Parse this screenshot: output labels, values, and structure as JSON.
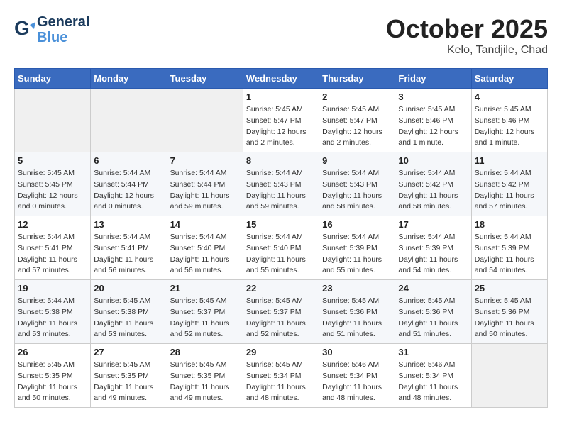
{
  "header": {
    "logo_line1": "General",
    "logo_line2": "Blue",
    "month": "October 2025",
    "location": "Kelo, Tandjile, Chad"
  },
  "weekdays": [
    "Sunday",
    "Monday",
    "Tuesday",
    "Wednesday",
    "Thursday",
    "Friday",
    "Saturday"
  ],
  "weeks": [
    [
      {
        "day": "",
        "info": ""
      },
      {
        "day": "",
        "info": ""
      },
      {
        "day": "",
        "info": ""
      },
      {
        "day": "1",
        "info": "Sunrise: 5:45 AM\nSunset: 5:47 PM\nDaylight: 12 hours and 2 minutes."
      },
      {
        "day": "2",
        "info": "Sunrise: 5:45 AM\nSunset: 5:47 PM\nDaylight: 12 hours and 2 minutes."
      },
      {
        "day": "3",
        "info": "Sunrise: 5:45 AM\nSunset: 5:46 PM\nDaylight: 12 hours and 1 minute."
      },
      {
        "day": "4",
        "info": "Sunrise: 5:45 AM\nSunset: 5:46 PM\nDaylight: 12 hours and 1 minute."
      }
    ],
    [
      {
        "day": "5",
        "info": "Sunrise: 5:45 AM\nSunset: 5:45 PM\nDaylight: 12 hours and 0 minutes."
      },
      {
        "day": "6",
        "info": "Sunrise: 5:44 AM\nSunset: 5:44 PM\nDaylight: 12 hours and 0 minutes."
      },
      {
        "day": "7",
        "info": "Sunrise: 5:44 AM\nSunset: 5:44 PM\nDaylight: 11 hours and 59 minutes."
      },
      {
        "day": "8",
        "info": "Sunrise: 5:44 AM\nSunset: 5:43 PM\nDaylight: 11 hours and 59 minutes."
      },
      {
        "day": "9",
        "info": "Sunrise: 5:44 AM\nSunset: 5:43 PM\nDaylight: 11 hours and 58 minutes."
      },
      {
        "day": "10",
        "info": "Sunrise: 5:44 AM\nSunset: 5:42 PM\nDaylight: 11 hours and 58 minutes."
      },
      {
        "day": "11",
        "info": "Sunrise: 5:44 AM\nSunset: 5:42 PM\nDaylight: 11 hours and 57 minutes."
      }
    ],
    [
      {
        "day": "12",
        "info": "Sunrise: 5:44 AM\nSunset: 5:41 PM\nDaylight: 11 hours and 57 minutes."
      },
      {
        "day": "13",
        "info": "Sunrise: 5:44 AM\nSunset: 5:41 PM\nDaylight: 11 hours and 56 minutes."
      },
      {
        "day": "14",
        "info": "Sunrise: 5:44 AM\nSunset: 5:40 PM\nDaylight: 11 hours and 56 minutes."
      },
      {
        "day": "15",
        "info": "Sunrise: 5:44 AM\nSunset: 5:40 PM\nDaylight: 11 hours and 55 minutes."
      },
      {
        "day": "16",
        "info": "Sunrise: 5:44 AM\nSunset: 5:39 PM\nDaylight: 11 hours and 55 minutes."
      },
      {
        "day": "17",
        "info": "Sunrise: 5:44 AM\nSunset: 5:39 PM\nDaylight: 11 hours and 54 minutes."
      },
      {
        "day": "18",
        "info": "Sunrise: 5:44 AM\nSunset: 5:39 PM\nDaylight: 11 hours and 54 minutes."
      }
    ],
    [
      {
        "day": "19",
        "info": "Sunrise: 5:44 AM\nSunset: 5:38 PM\nDaylight: 11 hours and 53 minutes."
      },
      {
        "day": "20",
        "info": "Sunrise: 5:45 AM\nSunset: 5:38 PM\nDaylight: 11 hours and 53 minutes."
      },
      {
        "day": "21",
        "info": "Sunrise: 5:45 AM\nSunset: 5:37 PM\nDaylight: 11 hours and 52 minutes."
      },
      {
        "day": "22",
        "info": "Sunrise: 5:45 AM\nSunset: 5:37 PM\nDaylight: 11 hours and 52 minutes."
      },
      {
        "day": "23",
        "info": "Sunrise: 5:45 AM\nSunset: 5:36 PM\nDaylight: 11 hours and 51 minutes."
      },
      {
        "day": "24",
        "info": "Sunrise: 5:45 AM\nSunset: 5:36 PM\nDaylight: 11 hours and 51 minutes."
      },
      {
        "day": "25",
        "info": "Sunrise: 5:45 AM\nSunset: 5:36 PM\nDaylight: 11 hours and 50 minutes."
      }
    ],
    [
      {
        "day": "26",
        "info": "Sunrise: 5:45 AM\nSunset: 5:35 PM\nDaylight: 11 hours and 50 minutes."
      },
      {
        "day": "27",
        "info": "Sunrise: 5:45 AM\nSunset: 5:35 PM\nDaylight: 11 hours and 49 minutes."
      },
      {
        "day": "28",
        "info": "Sunrise: 5:45 AM\nSunset: 5:35 PM\nDaylight: 11 hours and 49 minutes."
      },
      {
        "day": "29",
        "info": "Sunrise: 5:45 AM\nSunset: 5:34 PM\nDaylight: 11 hours and 48 minutes."
      },
      {
        "day": "30",
        "info": "Sunrise: 5:46 AM\nSunset: 5:34 PM\nDaylight: 11 hours and 48 minutes."
      },
      {
        "day": "31",
        "info": "Sunrise: 5:46 AM\nSunset: 5:34 PM\nDaylight: 11 hours and 48 minutes."
      },
      {
        "day": "",
        "info": ""
      }
    ]
  ]
}
